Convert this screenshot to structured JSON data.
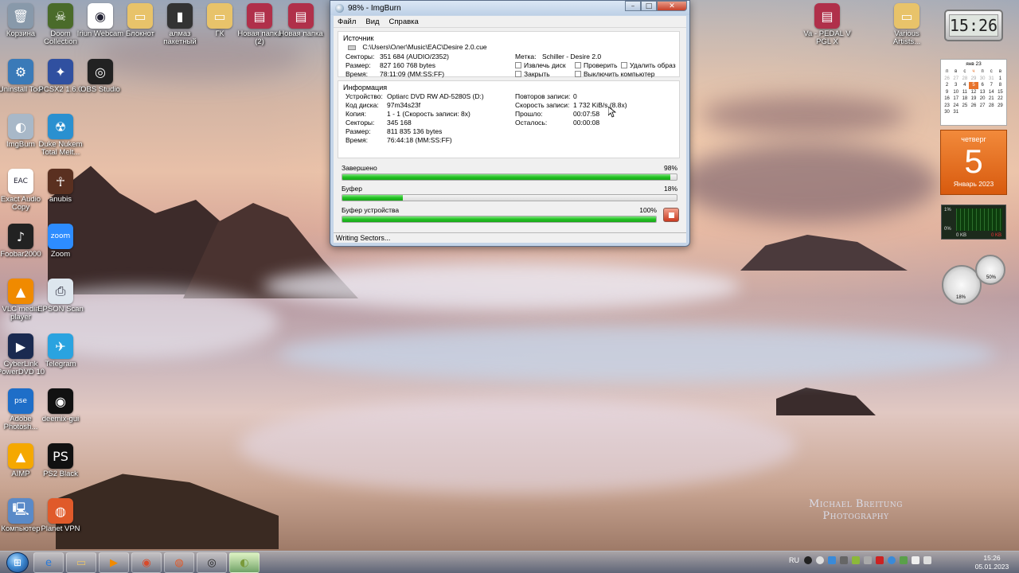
{
  "window": {
    "title": "98% - ImgBurn",
    "menu": [
      "Файл",
      "Вид",
      "Справка"
    ],
    "source": {
      "header": "Источник",
      "path": "C:\\Users\\Олег\\Music\\EAC\\Desire 2.0.cue",
      "sectors_label": "Секторы:",
      "sectors": "351 684 (AUDIO/2352)",
      "size_label": "Размер:",
      "size": "827 160 768 bytes",
      "time_label": "Время:",
      "time": "78:11:09 (MM:SS:FF)",
      "label_label": "Метка:",
      "label": "Schiller - Desire 2.0",
      "checks": [
        "Извлечь диск",
        "Проверить",
        "Удалить образ",
        "Закрыть",
        "Выключить компьютер"
      ]
    },
    "info": {
      "header": "Информация",
      "device_label": "Устройство:",
      "device": "Optiarc DVD RW AD-5280S (D:)",
      "disc_code_label": "Код диска:",
      "disc_code": "97m34s23f",
      "copy_label": "Копия:",
      "copy": "1 - 1 (Скорость записи: 8x)",
      "sectors_label": "Секторы:",
      "sectors": "345 168",
      "size_label": "Размер:",
      "size": "811 835 136 bytes",
      "time_label": "Время:",
      "time": "76:44:18 (MM:SS:FF)",
      "retries_label": "Повторов записи:",
      "retries": "0",
      "speed_label": "Скорость записи:",
      "speed": "1 732 KiB/s (8.8x)",
      "elapsed_label": "Прошло:",
      "elapsed": "00:07:58",
      "remaining_label": "Осталось:",
      "remaining": "00:00:08"
    },
    "progress": [
      {
        "label": "Завершено",
        "value": "98%",
        "fraction": 0.98
      },
      {
        "label": "Буфер",
        "value": "18%",
        "fraction": 0.18
      },
      {
        "label": "Буфер устройства",
        "value": "100%",
        "fraction": 1.0
      }
    ],
    "status": "Writing Sectors..."
  },
  "desktop_icons": [
    {
      "label": "Корзина",
      "icon": "recycle-bin-icon",
      "color": "#8899aa",
      "glyph": "🗑"
    },
    {
      "label": "Doom Collection",
      "icon": "doom-icon",
      "color": "#4a6b2a",
      "glyph": "☠"
    },
    {
      "label": "Iriun Webcam",
      "icon": "webcam-icon",
      "color": "#ffffff",
      "glyph": "◉"
    },
    {
      "label": "Блокнот",
      "icon": "folder-icon",
      "color": "#e8c36a",
      "glyph": "▭"
    },
    {
      "label": "алмаз пакетный",
      "icon": "usb-icon",
      "color": "#333333",
      "glyph": "▮"
    },
    {
      "label": "ГК",
      "icon": "folder-icon",
      "color": "#e8c36a",
      "glyph": "▭"
    },
    {
      "label": "Новая папка (2)",
      "icon": "folder-winrar-icon",
      "color": "#b0304a",
      "glyph": "▤"
    },
    {
      "label": "Новая папка",
      "icon": "folder-winrar-icon",
      "color": "#b0304a",
      "glyph": "▤"
    },
    {
      "label": "Uninstall Tool",
      "icon": "uninstall-tool-icon",
      "color": "#3a7ab8",
      "glyph": "⚙"
    },
    {
      "label": "PCSX2 1.6.0",
      "icon": "pcsx2-icon",
      "color": "#3050a0",
      "glyph": "✦"
    },
    {
      "label": "OBS Studio",
      "icon": "obs-icon",
      "color": "#222222",
      "glyph": "◎"
    },
    {
      "label": "ImgBurn",
      "icon": "imgburn-icon",
      "color": "#a8b8c8",
      "glyph": "◐"
    },
    {
      "label": "Duke Nukem Total Melt...",
      "icon": "duke-nukem-icon",
      "color": "#2a90d0",
      "glyph": "☢"
    },
    {
      "label": "Exact Audio Copy",
      "icon": "eac-icon",
      "color": "#ffffff",
      "glyph": "EAC"
    },
    {
      "label": "anubis",
      "icon": "anubis-icon",
      "color": "#5a3020",
      "glyph": "☥"
    },
    {
      "label": "Foobar2000",
      "icon": "foobar-icon",
      "color": "#222222",
      "glyph": "♪"
    },
    {
      "label": "Zoom",
      "icon": "zoom-icon",
      "color": "#2d8cff",
      "glyph": "zoom"
    },
    {
      "label": "VLC media player",
      "icon": "vlc-icon",
      "color": "#f08a00",
      "glyph": "▲"
    },
    {
      "label": "EPSON Scan",
      "icon": "epson-scan-icon",
      "color": "#dde6ee",
      "glyph": "⎙"
    },
    {
      "label": "CyberLink PowerDVD 10",
      "icon": "powerdvd-icon",
      "color": "#1a2a50",
      "glyph": "▶"
    },
    {
      "label": "Telegram",
      "icon": "telegram-icon",
      "color": "#2aa3e0",
      "glyph": "✈"
    },
    {
      "label": "Adobe Photosh...",
      "icon": "photoshop-icon",
      "color": "#1e6ec8",
      "glyph": "pse"
    },
    {
      "label": "deemix-gui",
      "icon": "deemix-icon",
      "color": "#111111",
      "glyph": "◉"
    },
    {
      "label": "AIMP",
      "icon": "aimp-icon",
      "color": "#f5a800",
      "glyph": "▲"
    },
    {
      "label": "PS2 Black",
      "icon": "ps2-icon",
      "color": "#111111",
      "glyph": "PS"
    },
    {
      "label": "Компьютер",
      "icon": "computer-icon",
      "color": "#5a8ac8",
      "glyph": "🖳"
    },
    {
      "label": "Planet VPN",
      "icon": "planet-vpn-icon",
      "color": "#e05a2a",
      "glyph": "◍"
    },
    {
      "label": "Va - PEDAL V PGL X",
      "icon": "folder-winrar-icon",
      "color": "#b0304a",
      "glyph": "▤"
    },
    {
      "label": "Various Artists...",
      "icon": "folder-icon",
      "color": "#e8c36a",
      "glyph": "▭"
    }
  ],
  "gadgets": {
    "clock": "15:26",
    "calendar_month": "янв 23",
    "calendar_weekdays": [
      "п",
      "в",
      "с",
      "ч",
      "п",
      "с",
      "в"
    ],
    "calendar_days": [
      [
        "26",
        "27",
        "28",
        "29",
        "30",
        "31",
        "1"
      ],
      [
        "2",
        "3",
        "4",
        "5",
        "6",
        "7",
        "8"
      ],
      [
        "9",
        "10",
        "11",
        "12",
        "13",
        "14",
        "15"
      ],
      [
        "16",
        "17",
        "18",
        "19",
        "20",
        "21",
        "22"
      ],
      [
        "23",
        "24",
        "25",
        "26",
        "27",
        "28",
        "29"
      ],
      [
        "30",
        "31",
        "",
        "",
        "",
        "",
        ""
      ]
    ],
    "day_name": "четверг",
    "day_number": "5",
    "month_year": "Январь 2023",
    "net_top": "1%",
    "net_mid": "0%",
    "net_left": "0 KB",
    "net_right": "0 KB",
    "gauge_cpu": "18%",
    "gauge_mem": "50%"
  },
  "watermark": [
    "Michael Breitung",
    "Photography"
  ],
  "taskbar": {
    "lang": "RU",
    "time": "15:26",
    "date": "05.01.2023",
    "buttons": [
      {
        "name": "ie-taskbar-button",
        "glyph": "e",
        "color": "#2a7ad8"
      },
      {
        "name": "explorer-taskbar-button",
        "glyph": "▭",
        "color": "#e8c36a"
      },
      {
        "name": "media-player-taskbar-button",
        "glyph": "▶",
        "color": "#f08a00"
      },
      {
        "name": "chrome-taskbar-button",
        "glyph": "◉",
        "color": "#d94a2a"
      },
      {
        "name": "planet-vpn-taskbar-button",
        "glyph": "◍",
        "color": "#e05a2a"
      },
      {
        "name": "obs-taskbar-button",
        "glyph": "◎",
        "color": "#222222"
      },
      {
        "name": "imgburn-taskbar-button",
        "glyph": "◐",
        "color": "#7a9a3a"
      }
    ]
  }
}
